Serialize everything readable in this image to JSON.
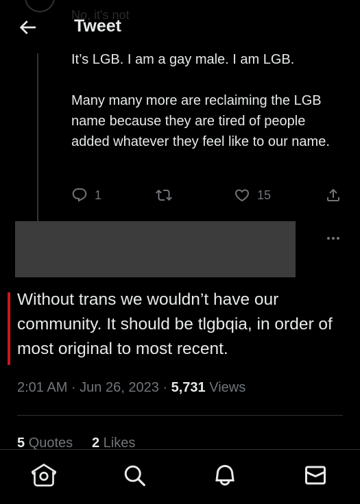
{
  "header": {
    "title": "Tweet",
    "back_icon": "arrow-left-icon",
    "ghost_text": "No, it's not"
  },
  "parent_tweet": {
    "text": "It’s LGB. I am a gay male. I am LGB.\n\nMany many more are reclaiming the LGB name because they are tired of people added whatever they feel like to our name.",
    "actions": {
      "replies": "1",
      "likes": "15"
    }
  },
  "main_tweet": {
    "text": "Without trans we wouldn’t have our community. It should be tlgbqia, in order of most original to most recent.",
    "time": "2:01 AM",
    "date": "Jun 26, 2023",
    "views_count": "5,731",
    "views_label": "Views",
    "quotes_count": "5",
    "quotes_label": "Quotes",
    "likes_count": "2",
    "likes_label": "Likes"
  },
  "bottom_nav": {
    "items": [
      "home-icon",
      "search-icon",
      "notifications-icon",
      "messages-icon"
    ]
  },
  "colors": {
    "background": "#000000",
    "text": "#e7e9ea",
    "muted": "#71767b",
    "divider": "#2f3336",
    "highlight_bar": "#d0161c",
    "redacted": "#3c3c3c"
  }
}
